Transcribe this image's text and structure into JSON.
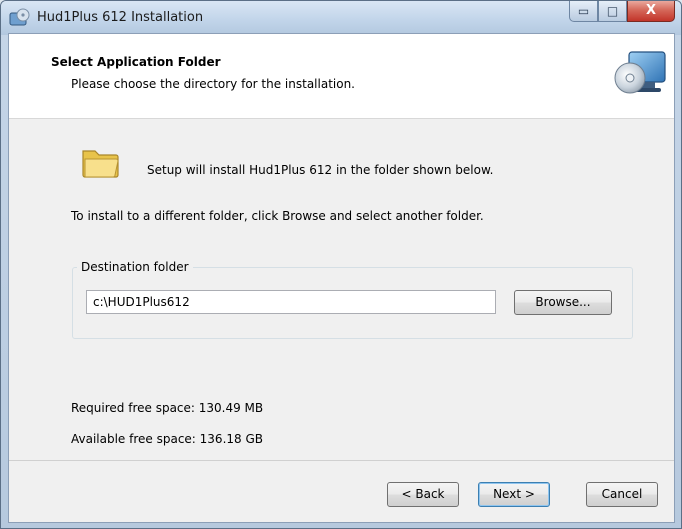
{
  "window": {
    "title": "Hud1Plus 612 Installation",
    "minimize_glyph": "▭",
    "maximize_glyph": "□",
    "close_glyph": "X",
    "app_icon": "installer-cd-icon"
  },
  "header": {
    "title": "Select Application Folder",
    "subtitle": "Please choose the directory for the installation.",
    "icon": "cd-monitor-icon"
  },
  "body": {
    "intro": "Setup will install Hud1Plus 612 in the folder shown below.",
    "hint": "To install to a different folder, click Browse and select another folder.",
    "folder_icon": "folder-icon",
    "destination": {
      "legend": "Destination folder",
      "path": "c:\\HUD1Plus612",
      "browse_label": "Browse..."
    },
    "required_space": "Required free space: 130.49 MB",
    "available_space": "Available free space: 136.18 GB"
  },
  "footer": {
    "back_label": "< Back",
    "next_label": "Next >",
    "cancel_label": "Cancel"
  }
}
